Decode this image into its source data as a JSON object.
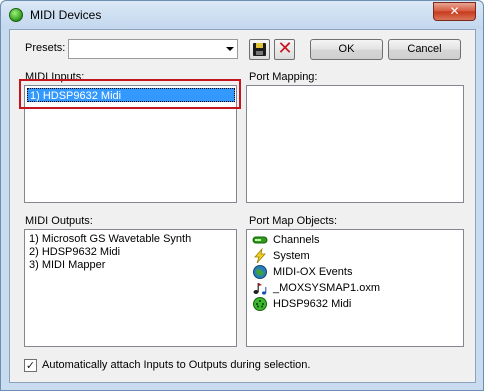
{
  "window": {
    "title": "MIDI Devices",
    "close_label": "✕"
  },
  "presets": {
    "label": "Presets:",
    "value": ""
  },
  "buttons": {
    "ok": "OK",
    "cancel": "Cancel"
  },
  "midi_inputs": {
    "label": "MIDI Inputs:",
    "items": [
      "1)  HDSP9632 Midi"
    ],
    "selected_index": 0
  },
  "port_mapping": {
    "label": "Port Mapping:",
    "items": []
  },
  "midi_outputs": {
    "label": "MIDI Outputs:",
    "items": [
      "1)  Microsoft GS Wavetable Synth",
      "2)  HDSP9632 Midi",
      "3)  MIDI Mapper"
    ]
  },
  "port_map_objects": {
    "label": "Port Map Objects:",
    "items": [
      {
        "label": "Channels",
        "icon": "channels-icon"
      },
      {
        "label": "System",
        "icon": "lightning-icon"
      },
      {
        "label": "MIDI-OX Events",
        "icon": "globe-icon"
      },
      {
        "label": "_MOXSYSMAP1.oxm",
        "icon": "music-note-icon"
      },
      {
        "label": "HDSP9632 Midi",
        "icon": "midi-device-icon"
      }
    ]
  },
  "auto_attach": {
    "label": "Automatically attach Inputs to Outputs during selection.",
    "checked": true
  },
  "colors": {
    "selection": "#3399ff",
    "highlight_box": "#c4161c"
  }
}
